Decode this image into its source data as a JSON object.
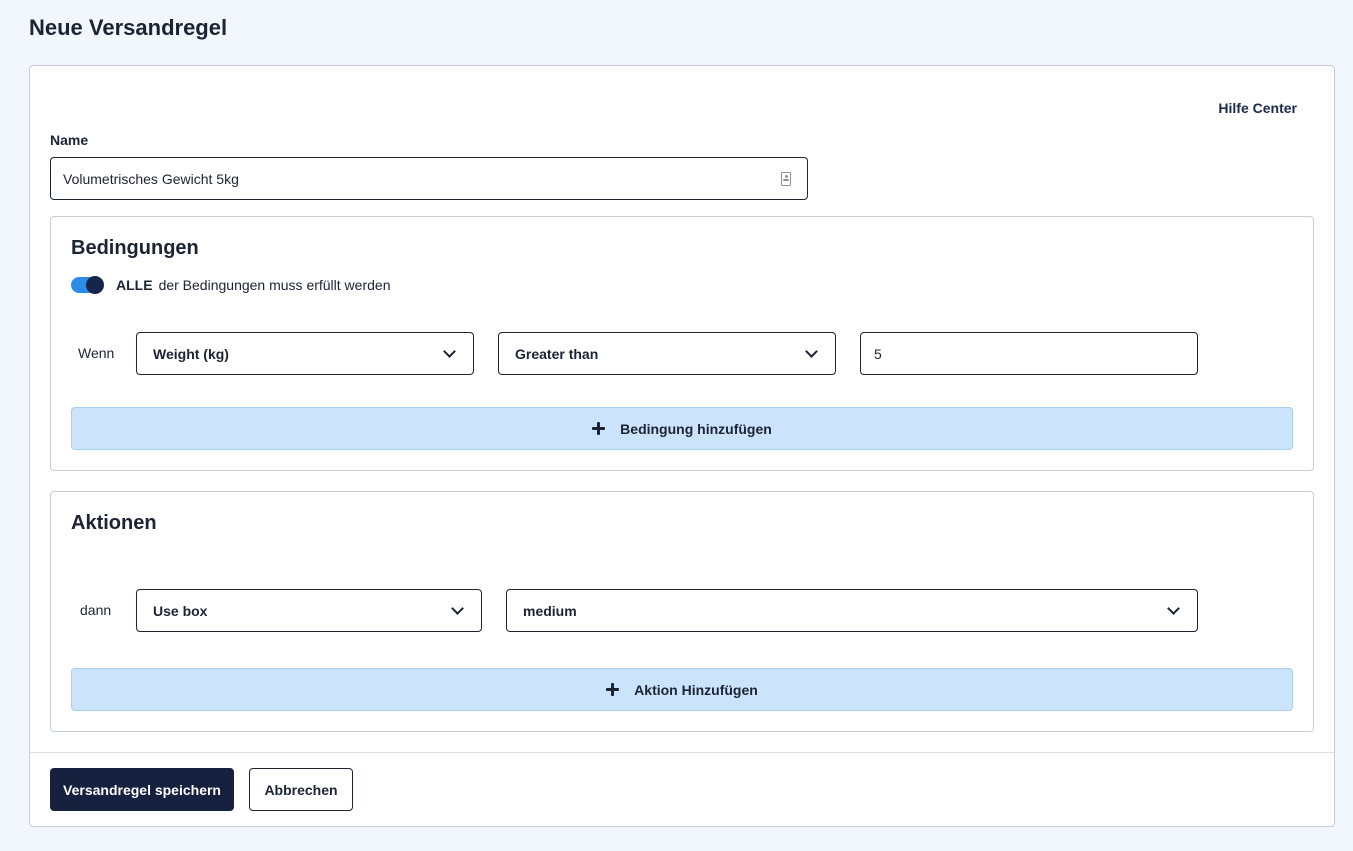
{
  "page": {
    "title": "Neue Versandregel"
  },
  "help": {
    "label": "Hilfe Center"
  },
  "name_field": {
    "label": "Name",
    "value": "Volumetrisches Gewicht 5kg",
    "icon": "contact-card-icon"
  },
  "conditions": {
    "title": "Bedingungen",
    "toggle": {
      "on": true,
      "strong": "ALLE",
      "text": "der Bedingungen muss erfüllt werden"
    },
    "rows": [
      {
        "label": "Wenn",
        "field": "Weight (kg)",
        "operator": "Greater than",
        "value": "5"
      }
    ],
    "add_label": "Bedingung hinzufügen"
  },
  "actions": {
    "title": "Aktionen",
    "rows": [
      {
        "label": "dann",
        "action": "Use box",
        "value": "medium"
      }
    ],
    "add_label": "Aktion Hinzufügen"
  },
  "footer": {
    "save_label": "Versandregel speichern",
    "cancel_label": "Abbrechen"
  },
  "colors": {
    "accent": "#2b8de8",
    "primary": "#16213f",
    "add_bg": "#cce4fb",
    "page_bg": "#f1f7fd"
  }
}
